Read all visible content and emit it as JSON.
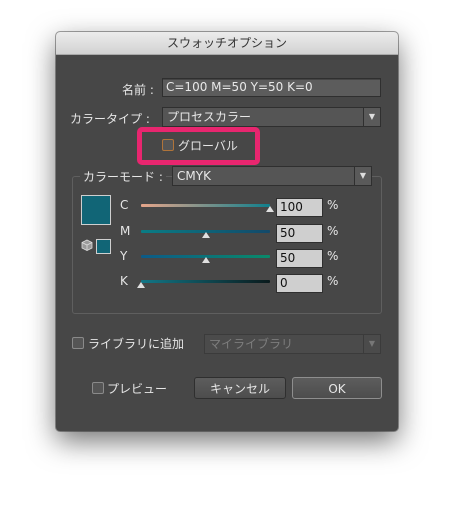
{
  "dialog": {
    "title": "スウォッチオプション",
    "name_label": "名前 :",
    "name_value": "C=100 M=50 Y=50 K=0",
    "color_type_label": "カラータイプ :",
    "color_type_value": "プロセスカラー",
    "global_label": "グローバル",
    "global_checked": false,
    "color_mode_label": "カラーモード :",
    "color_mode_value": "CMYK",
    "swatch_color": "#116576",
    "channels": [
      {
        "label": "C",
        "value": "100",
        "unit": "%",
        "level": 1.0,
        "gradient": [
          "#e6a58a",
          "#0f7f8c"
        ]
      },
      {
        "label": "M",
        "value": "50",
        "unit": "%",
        "level": 0.5,
        "gradient": [
          "#0a7d85",
          "#13496a"
        ]
      },
      {
        "label": "Y",
        "value": "50",
        "unit": "%",
        "level": 0.5,
        "gradient": [
          "#0c5a87",
          "#0a8a6a"
        ]
      },
      {
        "label": "K",
        "value": "0",
        "unit": "%",
        "level": 0.0,
        "gradient": [
          "#137787",
          "#0a1a1c"
        ]
      }
    ],
    "add_to_library_label": "ライブラリに追加",
    "library_value": "マイライブラリ",
    "preview_label": "プレビュー",
    "cancel_label": "キャンセル",
    "ok_label": "OK",
    "highlight_color": "#e8266f"
  }
}
